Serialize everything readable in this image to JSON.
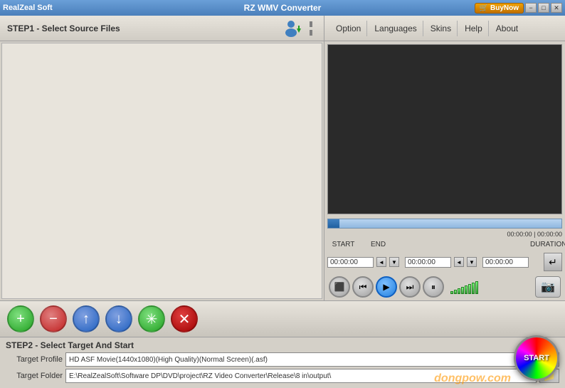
{
  "titleBar": {
    "appName": "RealZeal Soft",
    "appTitle": "RZ WMV Converter",
    "buyNow": "BuyNow",
    "minimize": "−",
    "maximize": "□",
    "close": "✕"
  },
  "step1": {
    "title": "STEP1 - Select Source Files"
  },
  "menuBar": {
    "option": "Option",
    "languages": "Languages",
    "skins": "Skins",
    "help": "Help",
    "about": "About"
  },
  "timeline": {
    "currentTime": "00:00:00",
    "totalTime": "00:00:00"
  },
  "trimControls": {
    "startLabel": "START",
    "endLabel": "END",
    "durationLabel": "DURATION",
    "startValue": "00:00:00",
    "endValue": "00:00:00",
    "durationValue": "00:00:00"
  },
  "toolbar": {
    "addTooltip": "Add Files",
    "removeTooltip": "Remove",
    "upTooltip": "Move Up",
    "downTooltip": "Move Down",
    "settingsTooltip": "Settings",
    "deleteTooltip": "Delete"
  },
  "step2": {
    "title": "STEP2 - Select Target And Start",
    "targetProfileLabel": "Target Profile",
    "targetProfileValue": "HD ASF Movie(1440x1080)(High Quality)(Normal Screen)(.asf)",
    "targetFolderLabel": "Target Folder",
    "targetFolderValue": "E:\\RealZealSoft\\Software DP\\DVD\\project\\RZ Video Converter\\Release\\8 in\\output\\"
  },
  "startBtn": "START",
  "watermark": "dongpow.com"
}
